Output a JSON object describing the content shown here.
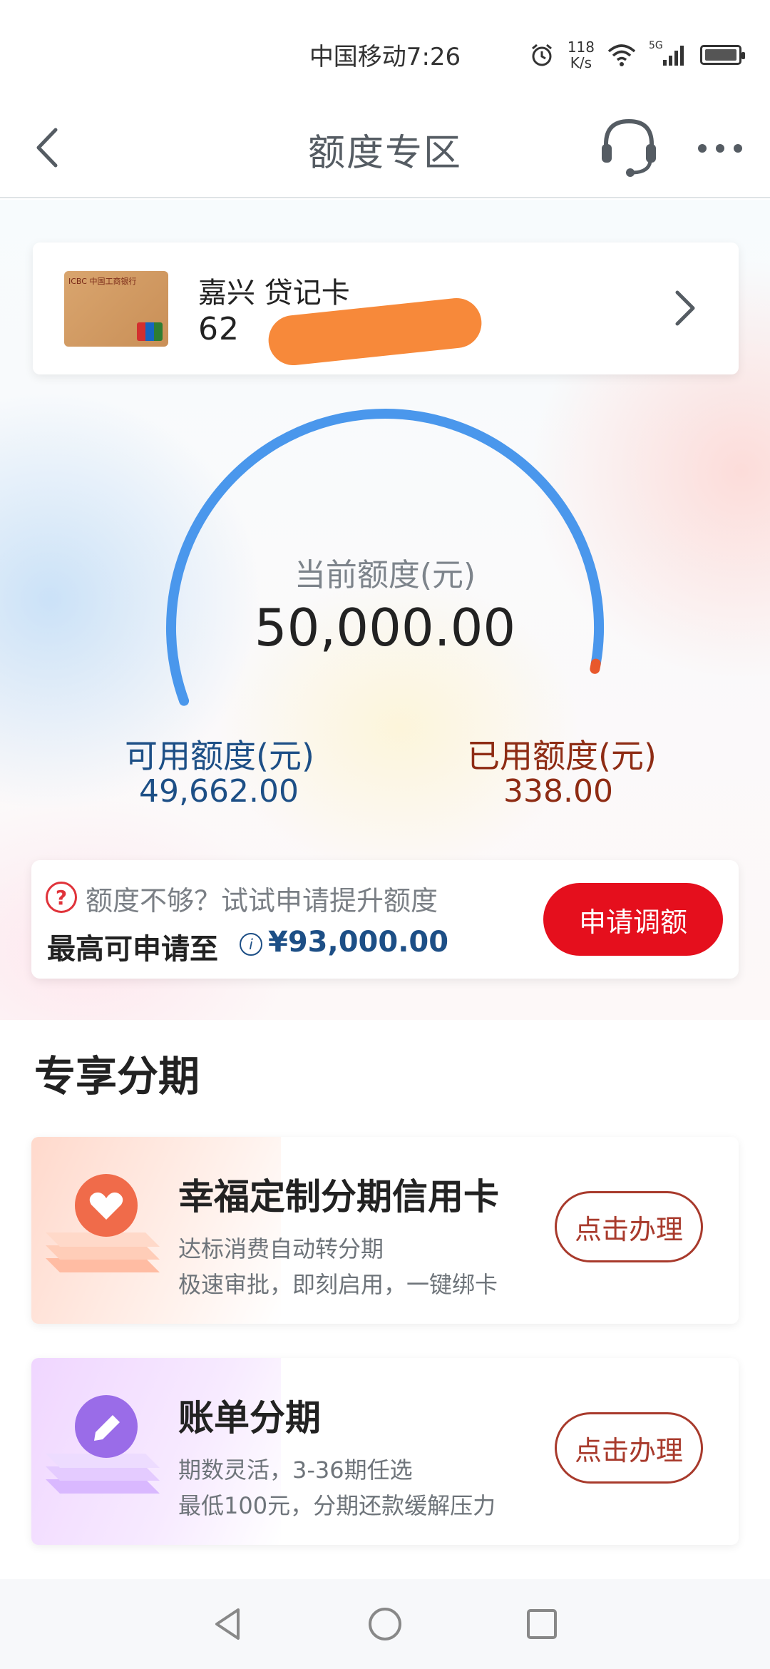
{
  "status_bar": {
    "carrier_time": "中国移动7:26",
    "speed_value": "118",
    "speed_unit": "K/s",
    "network": "5G"
  },
  "header": {
    "title": "额度专区"
  },
  "card": {
    "name": "嘉兴 贷记卡",
    "number_visible": "62",
    "card_logo_text": "ICBC 中国工商银行"
  },
  "gauge": {
    "label": "当前额度(元)",
    "value": "50,000.00",
    "used_fraction": 0.00676,
    "arc_color": "#4a97ec",
    "used_color": "#e8582c"
  },
  "limits": {
    "available_label": "可用额度(元)",
    "available_value": "49,662.00",
    "used_label": "已用额度(元)",
    "used_value": "338.00"
  },
  "raise": {
    "hint": "额度不够？试试申请提升额度",
    "max_label": "最高可申请至",
    "max_value": "¥93,000.00",
    "button": "申请调额"
  },
  "section": {
    "title": "专享分期"
  },
  "promos": [
    {
      "title": "幸福定制分期信用卡",
      "line1": "达标消费自动转分期",
      "line2": "极速审批，即刻启用，一键绑卡",
      "button": "点击办理",
      "icon": "heart-icon",
      "color": "#f06b4a"
    },
    {
      "title": "账单分期",
      "line1": "期数灵活，3-36期任选",
      "line2": "最低100元，分期还款缓解压力",
      "button": "点击办理",
      "icon": "pencil-icon",
      "color": "#9a6ce8"
    }
  ],
  "colors": {
    "accent_red": "#e50f1d",
    "blue_text": "#1d4f86",
    "brown_text": "#8e2c14"
  }
}
